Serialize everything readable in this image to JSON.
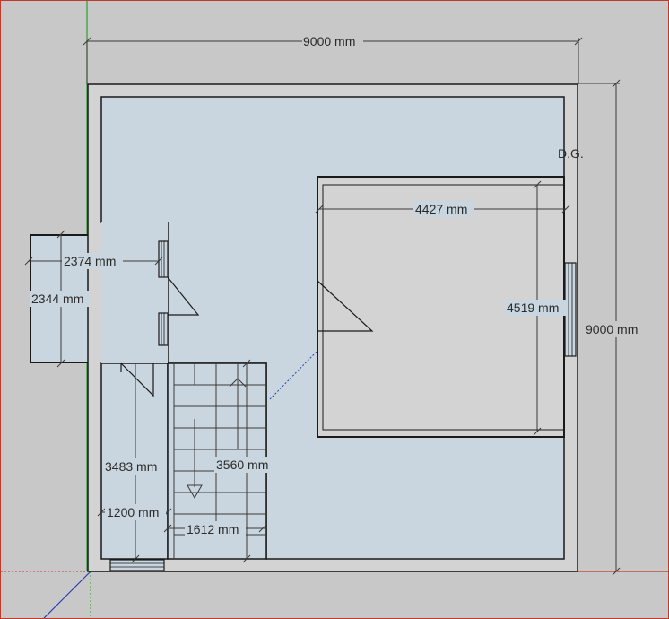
{
  "dimensions": {
    "overall_width": "9000 mm",
    "overall_height": "9000 mm",
    "room_width": "4427 mm",
    "room_height": "4519 mm",
    "left_box_width": "2374 mm",
    "left_box_height": "2344 mm",
    "passage_length": "3483 mm",
    "stair_length": "3560 mm",
    "passage_width": "1200 mm",
    "stair_width": "1612 mm"
  },
  "labels": {
    "dg": "D.G."
  },
  "colors": {
    "canvas": "#c8c8c8",
    "floor": "#c9d6df",
    "wall": "#1a1a1a",
    "dimension": "#3a3a3a"
  }
}
